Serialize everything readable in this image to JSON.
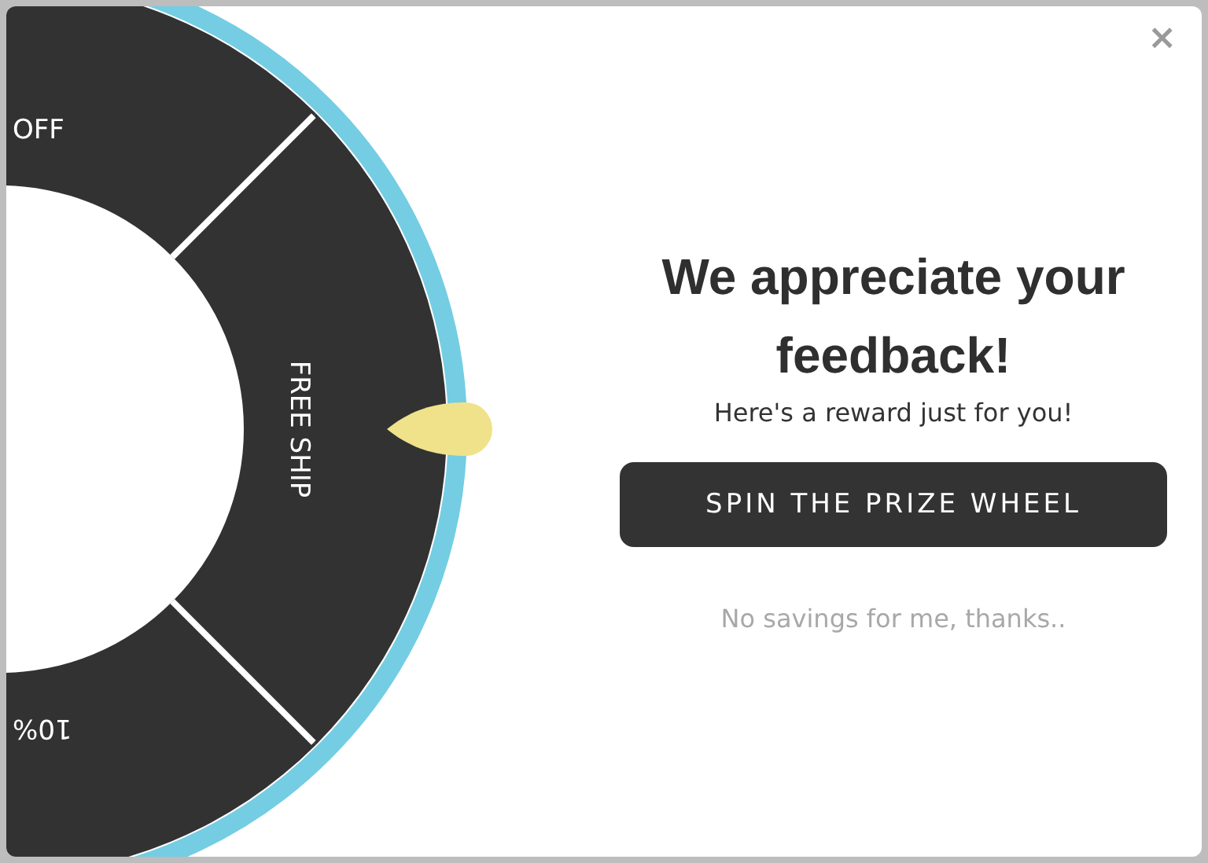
{
  "wheel": {
    "segments": [
      {
        "label": "OFF"
      },
      {
        "label": "FREE SHIP"
      },
      {
        "label": "10%"
      }
    ]
  },
  "close": {
    "label": "×"
  },
  "title": "We appreciate your feedback!",
  "subtitle": "Here's a reward just for you!",
  "primary_button": {
    "label": "SPIN THE PRIZE WHEEL"
  },
  "decline_link": {
    "label": "No savings for me, thanks.."
  }
}
